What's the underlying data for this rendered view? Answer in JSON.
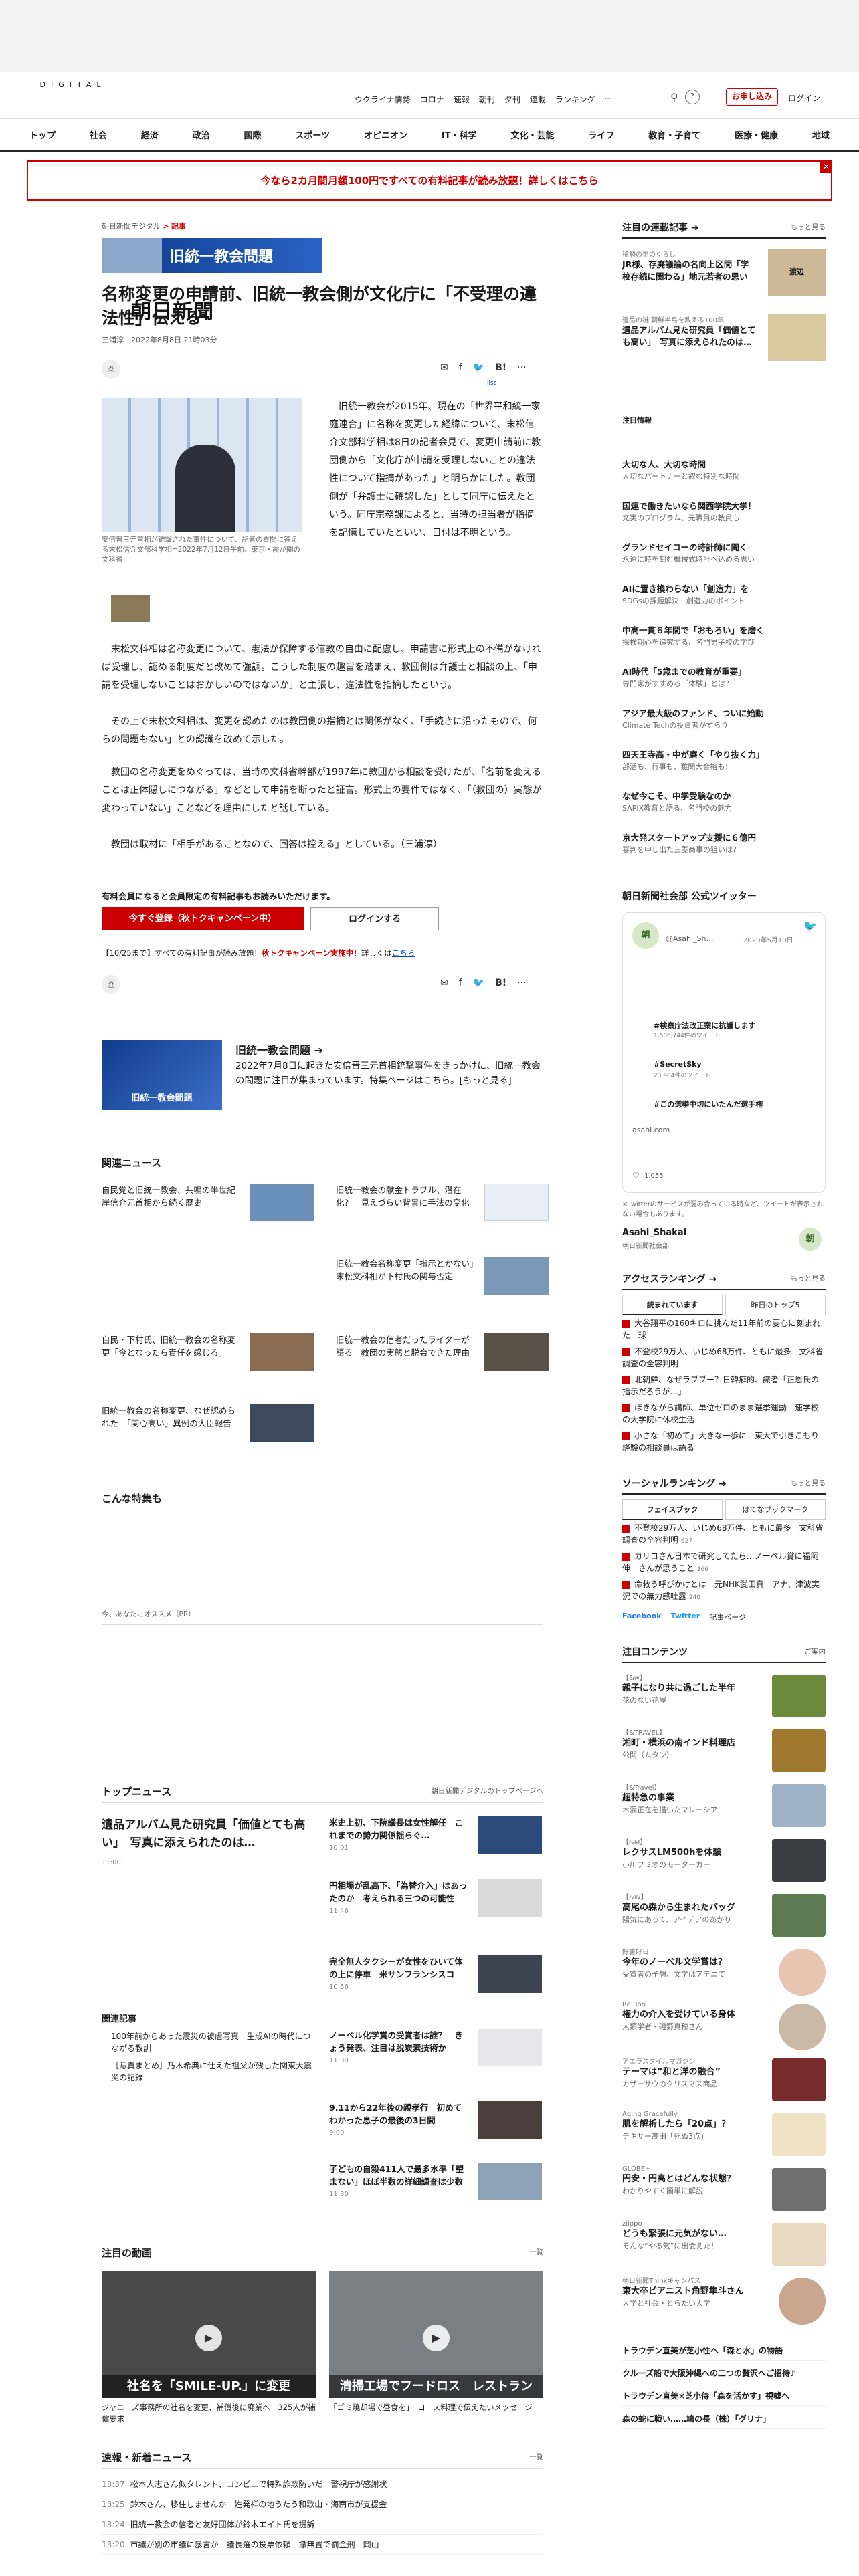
{
  "header": {
    "logo_main": "朝日新聞",
    "logo_sub": "DIGITAL",
    "topnav": [
      "ウクライナ情勢",
      "コロナ",
      "速報",
      "朝刊",
      "夕刊",
      "連載",
      "ランキング",
      "···"
    ],
    "subscribe": "お申し込み",
    "login": "ログイン"
  },
  "catnav": [
    "トップ",
    "社会",
    "経済",
    "政治",
    "国際",
    "スポーツ",
    "オピニオン",
    "IT・科学",
    "文化・芸能",
    "ライフ",
    "教育・子育て",
    "医療・健康",
    "地域"
  ],
  "promo": "今なら2カ月間月額100円ですべての有料記事が読み放題！詳しくはこちら",
  "article": {
    "crumb_site": "朝日新聞デジタル",
    "crumb_sep": ">",
    "crumb_cat": "記事",
    "banner": "旧統一教会問題",
    "title": "名称変更の申請前、旧統一教会側が文化庁に「不受理の違法性」伝える",
    "byline": "三浦淳　2022年8月8日 21時03分",
    "share_counts": "list",
    "caption": "安倍晋三元首相が銃撃された事件について、記者の質問に答える末松信介文部科学相=2022年7月12日午前、東京・霞が関の文科省",
    "p1": "　旧統一教会が2015年、現在の「世界平和統一家庭連合」に名称を変更した経緯について、末松信介文部科学相は8日の記者会見で、変更申請前に教団側から「文化庁が申請を受理しないことの違法性について指摘があった」と明らかにした。教団側が「弁護士に確認した」として同庁に伝えたという。同庁宗務課によると、当時の担当者が指摘を記憶していたといい、日付は不明という。",
    "p2": "　末松文科相は名称変更について、憲法が保障する信教の自由に配慮し、申請書に形式上の不備がなければ受理し、認める制度だと改めて強調。こうした制度の趣旨を踏まえ、教団側は弁護士と相談の上、「申請を受理しないことはおかしいのではないか」と主張し、違法性を指摘したという。",
    "p3": "　その上で末松文科相は、変更を認めたのは教団側の指摘とは関係がなく、「手続きに沿ったもので、何らの問題もない」との認識を改めて示した。",
    "p4": "　教団の名称変更をめぐっては、当時の文科省幹部が1997年に教団から相談を受けたが、「名前を変えることは正体隠しにつながる」などとして申請を断ったと証言。形式上の要件ではなく、「（教団の）実態が変わっていない」ことなどを理由にしたと話している。",
    "p5": "　教団は取材に「相手があることなので、回答は控える」としている。（三浦淳）",
    "notice": "有料会員になると会員限定の有料記事もお読みいただけます。",
    "reg_btn": "今すぐ登録（秋トクキャンペーン中）",
    "login_btn": "ログインする",
    "campaign_pre": "【10/25まで】すべての有料記事が読み放題！",
    "campaign_red": "秋トクキャンペーン実施中！",
    "campaign_post": "詳しくは",
    "campaign_link": "こちら"
  },
  "special": {
    "img": "旧統一教会問題",
    "h": "旧統一教会問題 ➔",
    "d": "2022年7月8日に起きた安倍晋三元首相銃撃事件をきっかけに、旧統一教会の問題に注目が集まっています。特集ページはこちら。[もっと見る]"
  },
  "related": {
    "head": "関連ニュース",
    "items": [
      "自民党と旧統一教会、共鳴の半世紀　岸信介元首相から続く歴史",
      "旧統一教会の献金トラブル、潜在化？　見えづらい背景に手法の変化",
      "旧統一教会名称変更「指示とかない」　末松文科相が下村氏の関与否定",
      "自民・下村氏、旧統一教会の名称変更「今となったら責任を感じる」",
      "旧統一教会の信者だったライターが語る　教団の実態と脱会できた理由",
      "旧統一教会の名称変更、なぜ認められた　「関心高い」異例の大臣報告"
    ]
  },
  "feature": {
    "head": "こんな特集も",
    "reco": "今、あなたにオススメ（PR）"
  },
  "topnews": {
    "head": "トップニュース",
    "link": "朝日新聞デジタルのトップページへ",
    "lead_title": "遺品アルバム見た研究員「価値とても高い」　写真に添えられたのは…",
    "lead_time": "11:00",
    "items": [
      {
        "t": "米史上初、下院議長は女性解任　これまでの勢力関係揺らぐ…",
        "ts": "10:01"
      },
      {
        "t": "円相場が乱高下、「為替介入」はあったのか　考えられる三つの可能性",
        "ts": "11:46"
      },
      {
        "t": "完全無人タクシーが女性をひいて体の上に停車　米サンフランシスコ",
        "ts": "10:56"
      },
      {
        "t": "ノーベル化学賞の受賞者は誰？　きょう発表、注目は脱炭素技術か",
        "ts": "11:30"
      },
      {
        "t": "9.11から22年後の親孝行　初めてわかった息子の最後の3日間",
        "ts": "9:00"
      },
      {
        "t": "子どもの自殺411人で最多水準「望まない」ほぼ半数の詳細調査は少数",
        "ts": "11:30"
      }
    ],
    "rel_head": "関連記事",
    "rel": [
      "100年前からあった震災の被虐写真　生成AIの時代につながる教訓",
      "［写真まとめ］乃木希典に仕えた祖父が残した関東大震災の記録"
    ]
  },
  "video": {
    "head": "注目の動画",
    "more": "一覧",
    "items": [
      {
        "label": "社名を「SMILE-UP.」に変更",
        "cap": "ジャニーズ事務所の社名を変更、補償後に廃業へ　325人が補償要求"
      },
      {
        "label": "清掃工場でフードロス　レストラン",
        "cap": "「ゴミ焼却場で昼食を」　コース料理で伝えたいメッセージ"
      }
    ]
  },
  "flash": {
    "head": "速報・新着ニュース",
    "more": "一覧",
    "items": [
      {
        "tm": "13:37",
        "t": "松本人志さん似タレント、コンビニで特殊詐欺防いだ　警視庁が感謝状"
      },
      {
        "tm": "13:25",
        "t": "鈴木さん、移住しませんか　姓発祥の地うたう和歌山・海南市が支援金"
      },
      {
        "tm": "13:24",
        "t": "旧統一教会の信者と友好団体が鈴木エイト氏を提訴"
      },
      {
        "tm": "13:20",
        "t": "市議が別の市議に暴言か　議長選の投票依頼　撤無置で罰金刑　岡山"
      }
    ]
  },
  "right": {
    "series_head": "注目の連載記事 ➔",
    "more": "もっと見る",
    "series": [
      {
        "l": "稀勢の里のくらし",
        "t": "JR様、存廃議論の名向上区間「学校存続に関わる」地元若者の思い",
        "img": "渡辺"
      },
      {
        "l": "遺品の謎 朝鮮半島を教える100年",
        "t": "遺品アルバム見た研究員「価値とても高い」　写真に添えられたのは…"
      }
    ],
    "pr_head": "注目情報",
    "pr": [
      {
        "t": "大切な人、大切な時間",
        "s": "大切なパートナーと叙む特別な時間"
      },
      {
        "t": "国連で働きたいなら関西学院大学！",
        "s": "充実のプログラム、元職員の教員も"
      },
      {
        "t": "グランドセイコーの時計師に聞く",
        "s": "永遠に時を刻む機械式時計へ込める思い"
      },
      {
        "t": "AIに置き換わらない「創造力」を",
        "s": "SDGsの課題解決　創造力のポイント"
      },
      {
        "t": "中高一貫６年間で「おもろい」を磨く",
        "s": "探検期心を追究する、名門男子校の学び"
      },
      {
        "t": "AI時代「5歳までの教育が重要」",
        "s": "専門家がすすめる「体験」とは？"
      },
      {
        "t": "アジア最大級のファンド、ついに始動",
        "s": "Climate Techの投資者がずらり"
      },
      {
        "t": "四天王寺高・中が磨く「やり抜く力」",
        "s": "部活も、行事も、難関大合格も！"
      },
      {
        "t": "なぜ今こそ、中学受験なのか",
        "s": "SAPIX教育と語る、名門校の魅力"
      },
      {
        "t": "京大発スタートアップ支援に６億円",
        "s": "審判を申し出た三菱商事の狙いは？"
      }
    ],
    "tw_head": "朝日新聞社会部 公式ツイッター",
    "tw_name": "@Asahi_Sh…",
    "tw_date": "2020年5月10日",
    "tw_trend": [
      "#検察庁法改正案に抗議します",
      "#SecretSky",
      "#この選挙中切にいたんだ選手権"
    ],
    "tw_counts": [
      "1,506,744件のツイート",
      "23,984件のツイート"
    ],
    "tw_url": "asahi.com",
    "tw_likes": "1,055",
    "tw_note": "※Twitterのサービスが混み合っている時など、ツイートが表示されない場合もあります。",
    "tw_acct": "Asahi_Shakai",
    "tw_acct_sub": "朝日新聞社会部",
    "rank_head": "アクセスランキング ➔",
    "rank_tabs": [
      "読まれています",
      "昨日のトップ5"
    ],
    "rank": [
      "大谷翔平の160キロに挑んだ11年前の要心に刻まれた一球",
      "不登校29万人、いじめ68万件、ともに最多　文科省調査の全容判明",
      "北朝鮮、なぜラブブー？日韓癖的、識者「正恩氏の指示だろうが…」",
      "ほきながら講師、単位ゼロのまま選挙運動　速学校の大学院に休校生活",
      "小さな「初めて」大きな一歩に　東大で引きこもり経験の相談員は語る"
    ],
    "social_head": "ソーシャルランキング ➔",
    "social_tabs": [
      "フェイスブック",
      "はてなブックマーク"
    ],
    "social": [
      {
        "t": "不登校29万人、いじめ68万件、ともに最多　文科省調査の全容判明",
        "c": "627"
      },
      {
        "t": "カリコさん日本で研究してたら…ノーベル賞に福岡伸一さんが思うこと",
        "c": "266"
      },
      {
        "t": "命救う呼びかけとは　元NHK武田真一アナ、津波実況での無力感吐露",
        "c": "240"
      }
    ],
    "social_links": [
      "Facebook",
      "Twitter",
      "記事ページ"
    ],
    "contents_head": "注目コンテンツ",
    "contents_more": "ご案内",
    "contents": [
      {
        "l": "【&w】",
        "t": "親子になり共に過ごした半年",
        "s": "花のない花屋"
      },
      {
        "l": "【&TRAVEL】",
        "t": "湘町・横浜の南インド料理店",
        "s": "公開（ムタン）"
      },
      {
        "l": "【&Travel】",
        "t": "超特急の事業",
        "s": "木漏正在を描いたマレーシア"
      },
      {
        "l": "【&M】",
        "t": "レクサスLM500hを体験",
        "s": "小川フミオのモーターカー"
      },
      {
        "l": "【&W】",
        "t": "高尾の森から生まれたバッグ",
        "s": "陽気にあって、アイデアのあかり"
      },
      {
        "l": "好書好日",
        "t": "今年のノーベル文学賞は？",
        "s": "受賞者の予想、文学はアテニて"
      },
      {
        "l": "Re:Ron",
        "t": "権力の介入を受けている身体",
        "s": "人類学者・磯野真穂さん"
      },
      {
        "l": "アエラスタイルマガジン",
        "t": "テーマは“和と洋の融合”",
        "s": "カザーサウのクリスマス商品"
      },
      {
        "l": "Aging Gracefully",
        "t": "肌を解析したら「20点」？",
        "s": "テキサー高田「死ぬ3点」"
      },
      {
        "l": "GLOBE+",
        "t": "円安・円高とはどんな状態？",
        "s": "わかりやすく簡単に解説"
      },
      {
        "l": "ziippo",
        "t": "どうも緊張に元気がない…",
        "s": "そんな“やる気”に出会えた！"
      },
      {
        "l": "朝日新聞Thinkキャンパス",
        "t": "東大卒ビアニスト角野隼斗さん",
        "s": "大学と社会・とらたい大学"
      }
    ],
    "plain": [
      "トラウデン直美が芝小性へ「森と水」の物語",
      "クルーズ船で大阪沖縄への二つの贅沢へご招待♪",
      "トラウデン直美×芝小侍「森を活かす」視嘘へ",
      "森の蛇に戦い……鳩の長（株）「グリナ」"
    ]
  }
}
